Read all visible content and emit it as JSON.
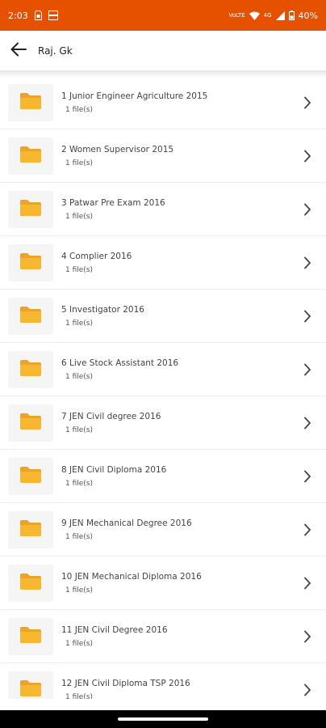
{
  "status_bar": {
    "time": "2:03",
    "left_icons": [
      "sim-card-icon",
      "hd-data-icon"
    ],
    "volte_label": "VoLTE",
    "network_label": "4G",
    "battery": "40%",
    "color": "#e65100"
  },
  "app_bar": {
    "title": "Raj. Gk"
  },
  "items": [
    {
      "title": "1 Junior Engineer Agriculture 2015",
      "count": "1 file(s)"
    },
    {
      "title": "2 Women Supervisor 2015",
      "count": "1 file(s)"
    },
    {
      "title": "3 Patwar Pre Exam 2016",
      "count": "1 file(s)"
    },
    {
      "title": "4 Complier 2016",
      "count": "1 file(s)"
    },
    {
      "title": "5 Investigator 2016",
      "count": "1 file(s)"
    },
    {
      "title": "6 Live Stock Assistant 2016",
      "count": "1 file(s)"
    },
    {
      "title": "7 JEN Civil degree 2016",
      "count": "1 file(s)"
    },
    {
      "title": "8 JEN Civil Diploma 2016",
      "count": "1 file(s)"
    },
    {
      "title": "9 JEN Mechanical Degree 2016",
      "count": "1 file(s)"
    },
    {
      "title": "10 JEN Mechanical Diploma 2016",
      "count": "1 file(s)"
    },
    {
      "title": "11 JEN Civil Degree 2016",
      "count": "1 file(s)"
    },
    {
      "title": "12 JEN Civil Diploma TSP 2016",
      "count": "1 file(s)"
    }
  ],
  "colors": {
    "folder": "#f7b731",
    "folder_back": "#eba32a"
  }
}
